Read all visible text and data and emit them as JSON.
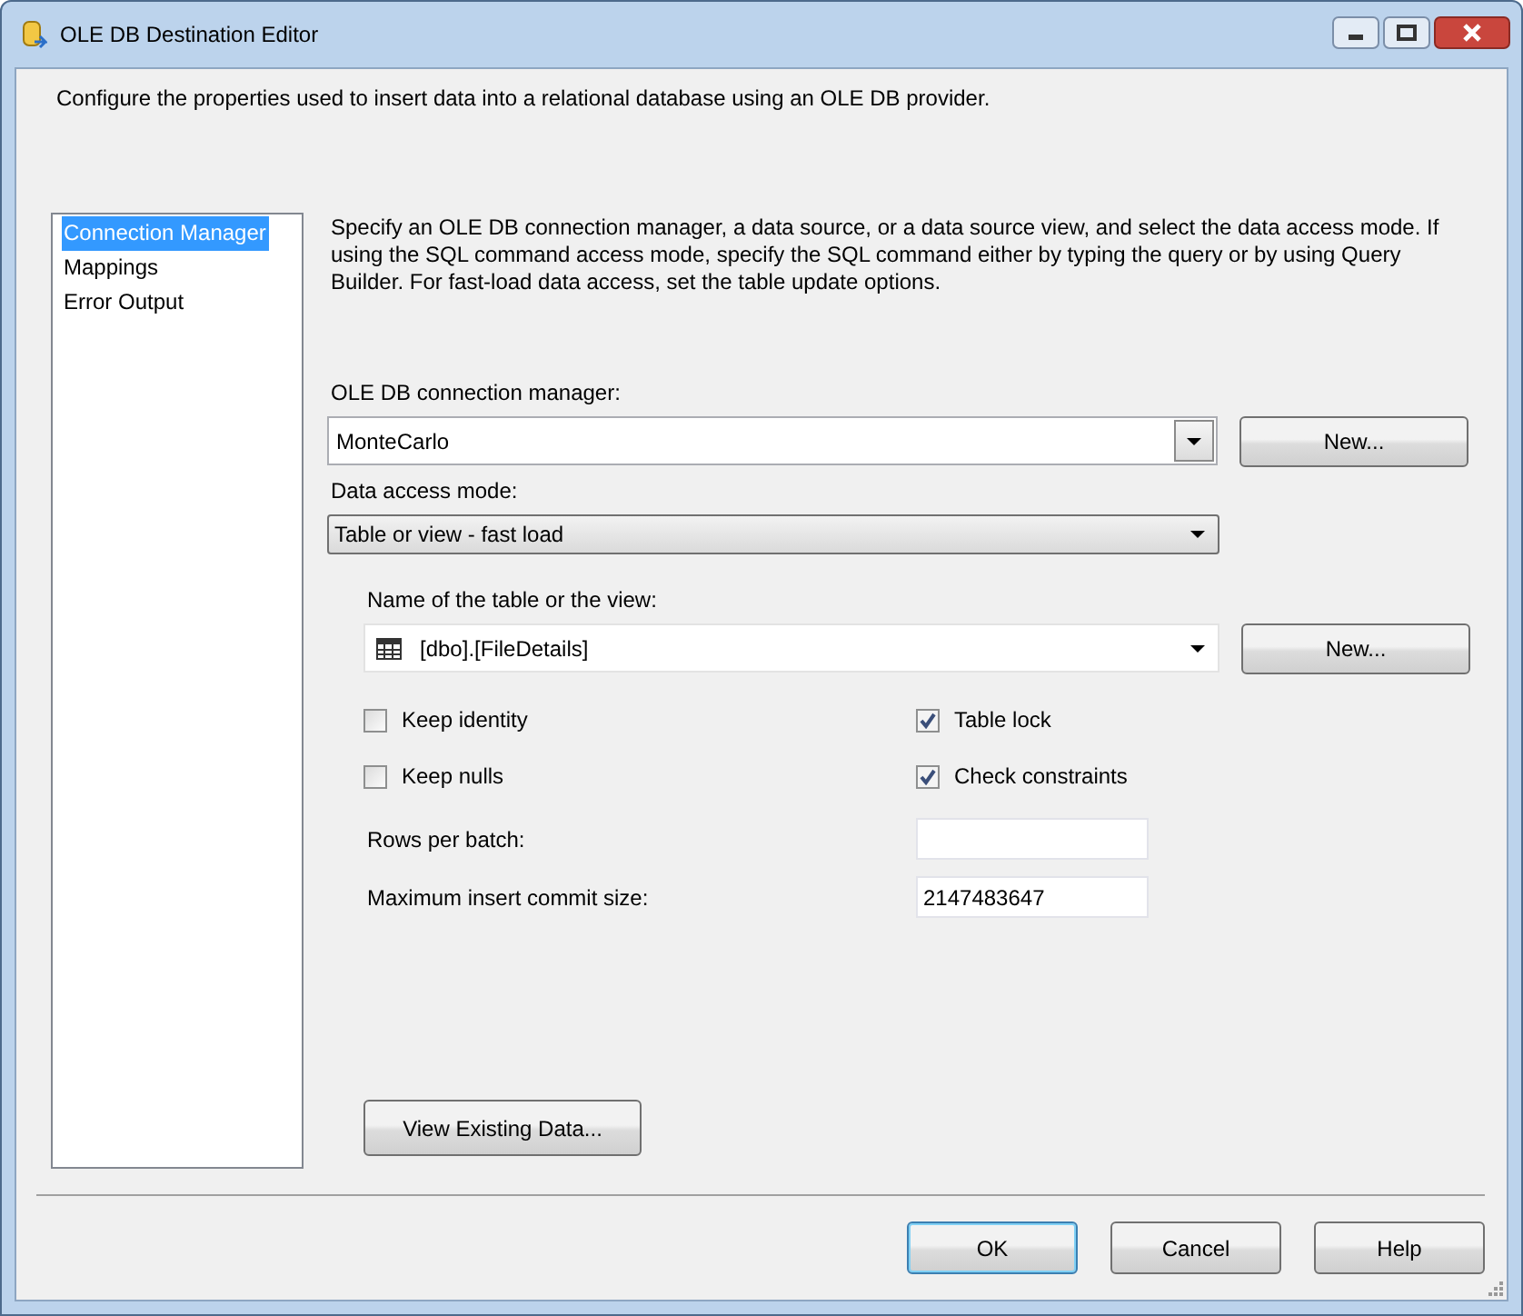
{
  "window": {
    "title": "OLE DB Destination Editor"
  },
  "description": "Configure the properties used to insert data into a relational database using an OLE DB provider.",
  "sidebar": {
    "items": [
      {
        "label": "Connection Manager",
        "selected": true
      },
      {
        "label": "Mappings",
        "selected": false
      },
      {
        "label": "Error Output",
        "selected": false
      }
    ]
  },
  "panel": {
    "instructions": "Specify an OLE DB connection manager, a data source, or a data source view, and select the data access mode. If using the SQL command access mode, specify the SQL command either by typing the query or by using Query Builder. For fast-load data access, set the table update options.",
    "connection_manager": {
      "label": "OLE DB connection manager:",
      "value": "MonteCarlo",
      "button": "New..."
    },
    "access_mode": {
      "label": "Data access mode:",
      "value": "Table or view - fast load"
    },
    "table_name": {
      "label": "Name of the table or the view:",
      "value": "[dbo].[FileDetails]",
      "button": "New..."
    },
    "options": [
      {
        "label": "Keep identity",
        "checked": false
      },
      {
        "label": "Table lock",
        "checked": true
      },
      {
        "label": "Keep nulls",
        "checked": false
      },
      {
        "label": "Check constraints",
        "checked": true
      }
    ],
    "fields": [
      {
        "label": "Rows per batch:"
      },
      {
        "label": "Maximum insert commit size:",
        "value": "2147483647"
      }
    ],
    "view_button": "View Existing Data..."
  },
  "buttons": [
    {
      "label": "OK",
      "default": true
    },
    {
      "label": "Cancel",
      "default": false
    },
    {
      "label": "Help",
      "default": false
    }
  ]
}
